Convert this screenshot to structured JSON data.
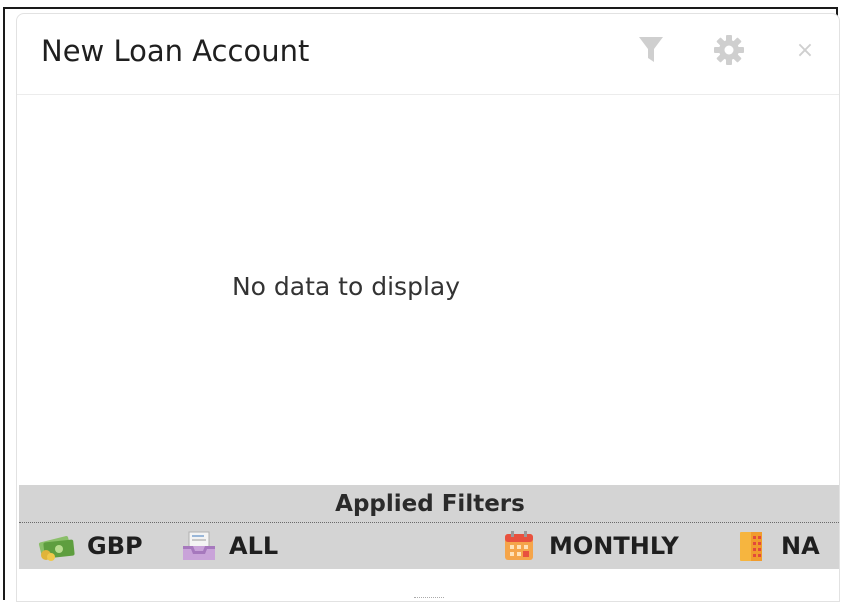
{
  "widget": {
    "title": "New Loan Account",
    "toolbar": {
      "filter_icon": "filter-icon",
      "settings_icon": "gear-icon",
      "close_label": "×"
    },
    "empty_message": "No data to display"
  },
  "applied_filters": {
    "title": "Applied Filters",
    "items": [
      {
        "icon": "money-icon",
        "label": "GBP"
      },
      {
        "icon": "inbox-tray-icon",
        "label": "ALL"
      },
      {
        "icon": "calendar-icon",
        "label": "MONTHLY"
      },
      {
        "icon": "building-icon",
        "label": "NA"
      }
    ]
  },
  "colors": {
    "toolbar_icon": "#cfcfcf",
    "filters_background": "#d4d4d4",
    "calendar_accent": "#f08a24",
    "money_accent": "#6aa84f"
  }
}
